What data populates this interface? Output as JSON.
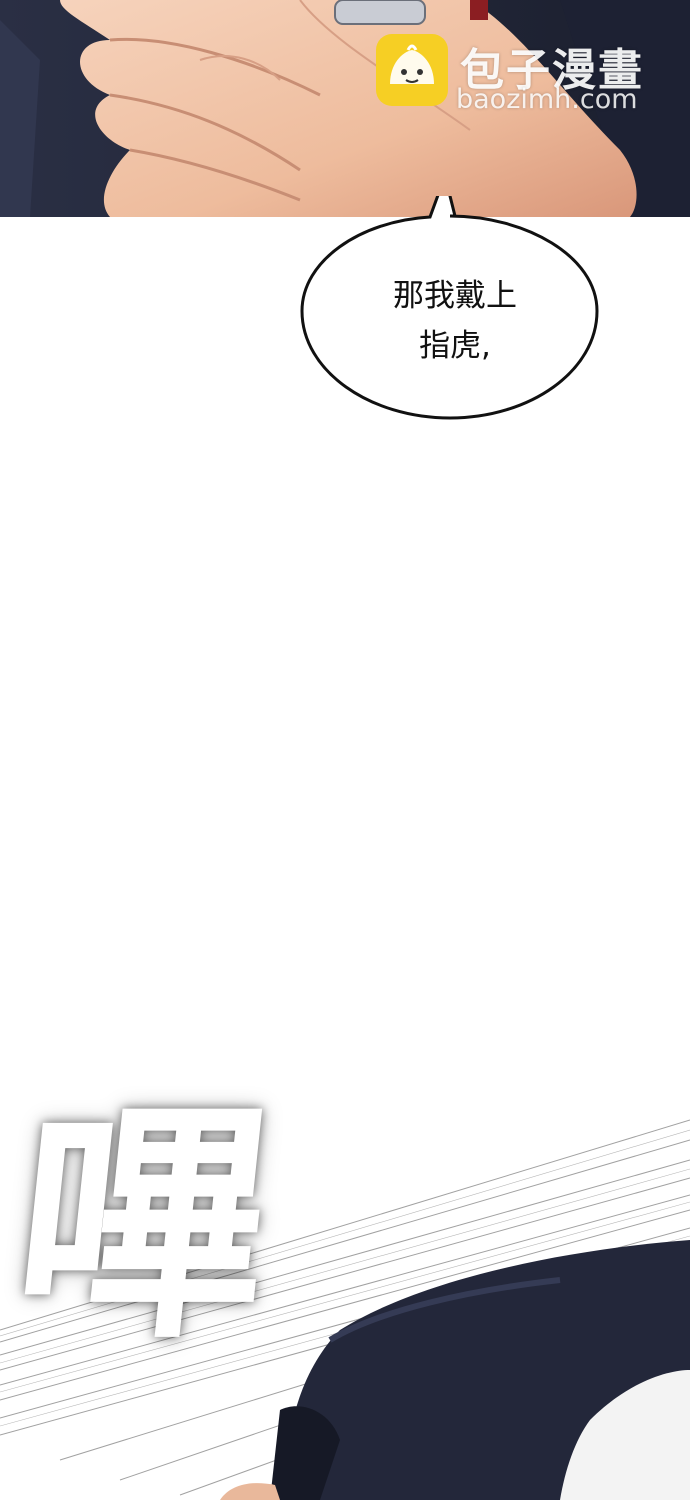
{
  "watermark": {
    "title": "包子漫畫",
    "url": "baozimh.com",
    "logo_icon": "steamed-bun-icon",
    "logo_color": "#f6cf24"
  },
  "dialogue": {
    "line1": "那我戴上",
    "line2": "指虎,"
  },
  "sound_effect": {
    "text": "嗶"
  },
  "colors": {
    "background": "#ffffff",
    "suit_navy": "#23273a",
    "skin": "#f0c3a6"
  }
}
